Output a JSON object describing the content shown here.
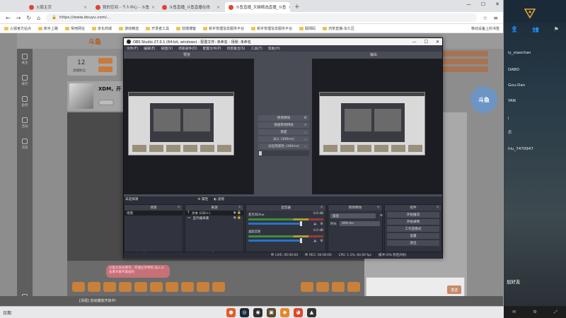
{
  "browser": {
    "tabs": [
      {
        "label": "火狐主页",
        "active": false
      },
      {
        "label": "我的空间 - 个人中心 - 斗鱼",
        "active": false
      },
      {
        "label": "斗鱼直播_斗鱼直播在线",
        "active": false
      },
      {
        "label": "斗鱼直播_天猫精选直播_斗鱼",
        "active": true
      }
    ],
    "new_tab": "+",
    "url": "https://www.douyu.com/...",
    "bookmarks": [
      "火狐官方站点",
      "新手上路",
      "常用网址",
      "京东商城",
      "游戏精选",
      "开发者工具",
      "前端博客",
      "新手管理信息服务平台",
      "新手管理信息服务平台",
      "联网码",
      "鸿茶直播-永久区"
    ],
    "bookmarks_right": "移动设备上的书签"
  },
  "douyu": {
    "logo": "斗鱼",
    "stat_number": "12",
    "stat_label": "直播粉丝",
    "streamer_name": "XDM，开",
    "promo_text": "斗鱼大会员尊享，开通立享特权 加入斗鱼尊享群专属福利",
    "left_nav": [
      "关注",
      "排行",
      "鱼吧",
      "活动",
      "消息",
      "直播"
    ],
    "send_label": "发送",
    "footer_text": "[清视] 自动播放开启中！",
    "mascot": "斗鱼"
  },
  "obs": {
    "title": "OBS Studio 27.0.1 (64-bit, windows) - 配置文件: 未命名 - 场景: 未命名",
    "menu": [
      "文件(F)",
      "编辑(E)",
      "视图(V)",
      "停靠部件(D)",
      "配置文件(P)",
      "场景集合(S)",
      "工具(T)",
      "帮助(H)"
    ],
    "preview_label": "预览",
    "program_label": "输出",
    "transition_buttons": [
      "转场特效",
      "快速转场特效",
      "渐变",
      "淡入 (300ms)",
      "淡出到黑色 (300ms)"
    ],
    "scene_selected_label": "未选择源",
    "props_label": "属性",
    "filters_label": "滤镜",
    "docks": {
      "scenes": {
        "title": "场景",
        "items": [
          "场景"
        ]
      },
      "sources": {
        "title": "来源",
        "items": [
          "文本 (GDI+)",
          "显示器采集"
        ]
      },
      "mixer": {
        "title": "混音器",
        "channels": [
          {
            "name": "麦克风/Aux",
            "db": "0.0 dB"
          },
          {
            "name": "桌面音频",
            "db": "0.0 dB"
          }
        ]
      },
      "transitions": {
        "title": "转场特效",
        "selected": "渐变",
        "duration_label": "时长",
        "duration_value": "300 ms"
      },
      "controls": {
        "title": "控件",
        "buttons": [
          "开始推流",
          "开始录制",
          "工作室模式",
          "设置",
          "退出"
        ]
      }
    },
    "status": {
      "live": "LIVE: 00:00:00",
      "rec": "REC: 00:00:00",
      "cpu": "CPU: 1.1%, 60.00 fps",
      "fps_alert": "缓冲 (0% 秒后开始)"
    }
  },
  "friends": {
    "names": [
      "ly_xiaochan",
      "DABO",
      "Gou-Dan",
      "YAN",
      "i",
      "乐",
      "hiu_7470947"
    ],
    "add_label": "加好友"
  },
  "taskbar": {
    "left_text": "日期",
    "icons": [
      "chrome",
      "steam",
      "obs",
      "game",
      "douyu",
      "firefox",
      "app"
    ]
  },
  "colors": {
    "obs_bg": "#2b2e38",
    "obs_panel": "#4a4c55",
    "accent": "#2a71c9",
    "douyu_orange": "#c8803a"
  }
}
